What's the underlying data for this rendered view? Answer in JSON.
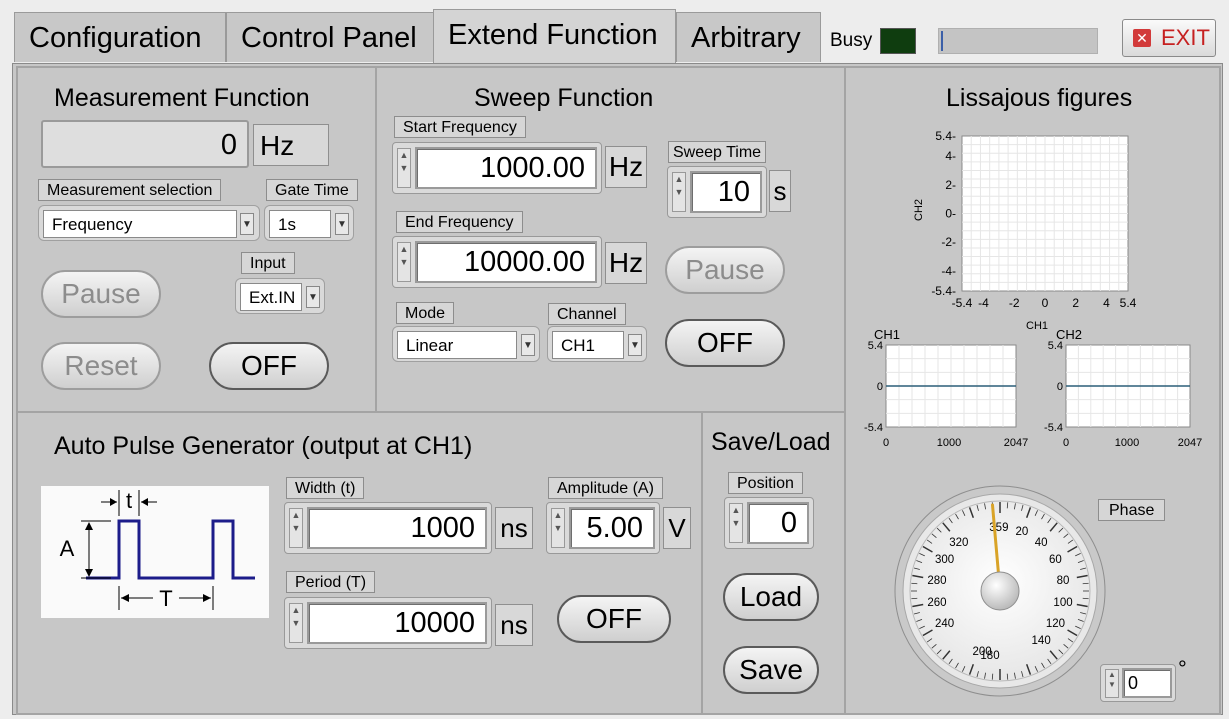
{
  "tabs": [
    "Configuration",
    "Control Panel",
    "Extend Function",
    "Arbitrary"
  ],
  "busy_label": "Busy",
  "exit_label": "EXIT",
  "measurement": {
    "title": "Measurement Function",
    "value": "0",
    "unit": "Hz",
    "selection_label": "Measurement selection",
    "selection_value": "Frequency",
    "gate_label": "Gate Time",
    "gate_value": "1s",
    "input_label": "Input",
    "input_value": "Ext.IN",
    "pause": "Pause",
    "reset": "Reset",
    "off": "OFF"
  },
  "sweep": {
    "title": "Sweep Function",
    "start_label": "Start Frequency",
    "start_value": "1000.00",
    "start_unit": "Hz",
    "end_label": "End  Frequency",
    "end_value": "10000.00",
    "end_unit": "Hz",
    "time_label": "Sweep Time",
    "time_value": "10",
    "time_unit": "s",
    "mode_label": "Mode",
    "mode_value": "Linear",
    "channel_label": "Channel",
    "channel_value": "CH1",
    "pause": "Pause",
    "off": "OFF"
  },
  "lissajous": {
    "title": "Lissajous figures",
    "xlabel": "CH1",
    "ylabel": "CH2",
    "xticks": [
      "-5.4",
      "-4",
      "-2",
      "0",
      "2",
      "4",
      "5.4"
    ],
    "yticks": [
      "5.4",
      "4",
      "2",
      "0",
      "-2",
      "-4",
      "-5.4"
    ],
    "ch1": {
      "label": "CH1",
      "yticks": [
        "5.4",
        "0",
        "-5.4"
      ],
      "xticks": [
        "0",
        "1000",
        "2047"
      ]
    },
    "ch2": {
      "label": "CH2",
      "yticks": [
        "5.4",
        "0",
        "-5.4"
      ],
      "xticks": [
        "0",
        "1000",
        "2047"
      ]
    },
    "phase_label": "Phase",
    "phase_value": "0",
    "phase_unit": "°",
    "gauge_labels": [
      "359",
      "20",
      "40",
      "60",
      "80",
      "100",
      "120",
      "140",
      "180",
      "200",
      "240",
      "260",
      "280",
      "300",
      "320"
    ],
    "gauge_value": 359
  },
  "pulse": {
    "title": "Auto Pulse Generator (output at CH1)",
    "diagram": {
      "t": "t",
      "A": "A",
      "T": "T"
    },
    "width_label": "Width (t)",
    "width_value": "1000",
    "width_unit": "ns",
    "amp_label": "Amplitude (A)",
    "amp_value": "5.00",
    "amp_unit": "V",
    "period_label": "Period (T)",
    "period_value": "10000",
    "period_unit": "ns",
    "off": "OFF"
  },
  "saveload": {
    "title": "Save/Load",
    "position_label": "Position",
    "position_value": "0",
    "load": "Load",
    "save": "Save"
  }
}
